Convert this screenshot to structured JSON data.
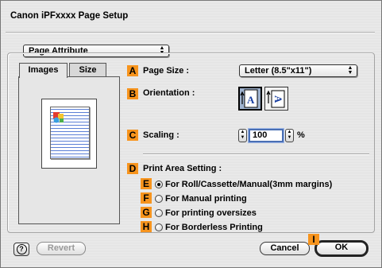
{
  "window": {
    "title": "Canon iPFxxxx Page Setup"
  },
  "panel_popup": {
    "value": "Page Attribute"
  },
  "tabs": [
    {
      "label": "Images"
    },
    {
      "label": "Size"
    }
  ],
  "badges": {
    "A": "A",
    "B": "B",
    "C": "C",
    "D": "D",
    "E": "E",
    "F": "F",
    "G": "G",
    "H": "H",
    "I": "I"
  },
  "page_size": {
    "label": "Page Size :",
    "value": "Letter (8.5\"x11\")"
  },
  "orientation": {
    "label": "Orientation :",
    "selected": "portrait",
    "portrait_glyph": "A",
    "landscape_glyph": "A"
  },
  "scaling": {
    "label": "Scaling :",
    "value": "100",
    "unit": "%"
  },
  "print_area": {
    "label": "Print Area Setting :",
    "options": [
      {
        "label": "For Roll/Cassette/Manual(3mm margins)",
        "selected": true
      },
      {
        "label": "For Manual printing",
        "selected": false
      },
      {
        "label": "For printing oversizes",
        "selected": false
      },
      {
        "label": "For Borderless Printing",
        "selected": false
      }
    ]
  },
  "footer": {
    "help_icon": "question-mark-icon",
    "help_glyph": "?",
    "revert_label": "Revert",
    "cancel_label": "Cancel",
    "ok_label": "OK"
  },
  "colors": {
    "badge": "#f7941d",
    "selected_orientation": "#9fb3cf",
    "preview_lines": "#5b7fd6"
  }
}
